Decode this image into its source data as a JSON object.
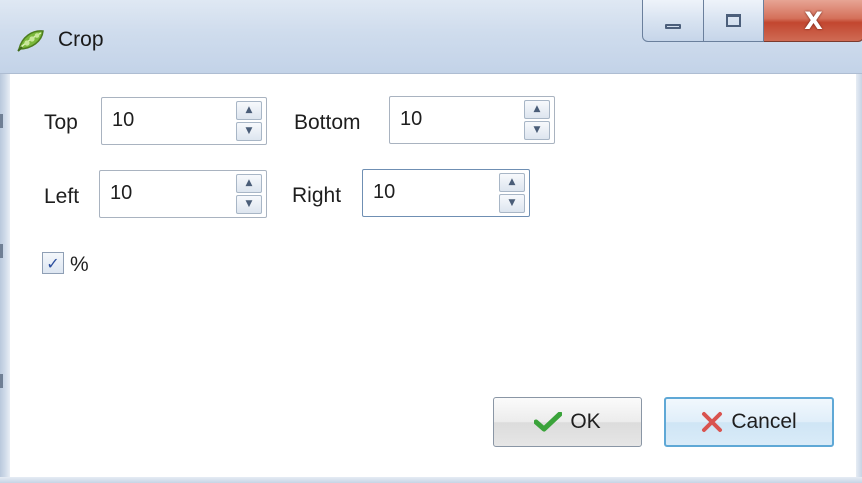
{
  "window": {
    "title": "Crop",
    "app_icon": "pea-pod-icon",
    "controls": {
      "minimize_icon": "minimize-icon",
      "maximize_icon": "maximize-icon",
      "close_icon": "close-icon",
      "close_glyph": "X"
    }
  },
  "form": {
    "top": {
      "label": "Top",
      "value": "10"
    },
    "bottom": {
      "label": "Bottom",
      "value": "10"
    },
    "left": {
      "label": "Left",
      "value": "10"
    },
    "right": {
      "label": "Right",
      "value": "10"
    },
    "percent": {
      "label": "%",
      "checked": true
    }
  },
  "buttons": {
    "ok": {
      "label": "OK",
      "icon": "checkmark-icon"
    },
    "cancel": {
      "label": "Cancel",
      "icon": "x-icon"
    }
  },
  "colors": {
    "ok_check": "#3aa33a",
    "cancel_x": "#d9534f",
    "cancel_focus_border": "#5fa8d6",
    "checkbox_mark": "#2c4f9e"
  }
}
